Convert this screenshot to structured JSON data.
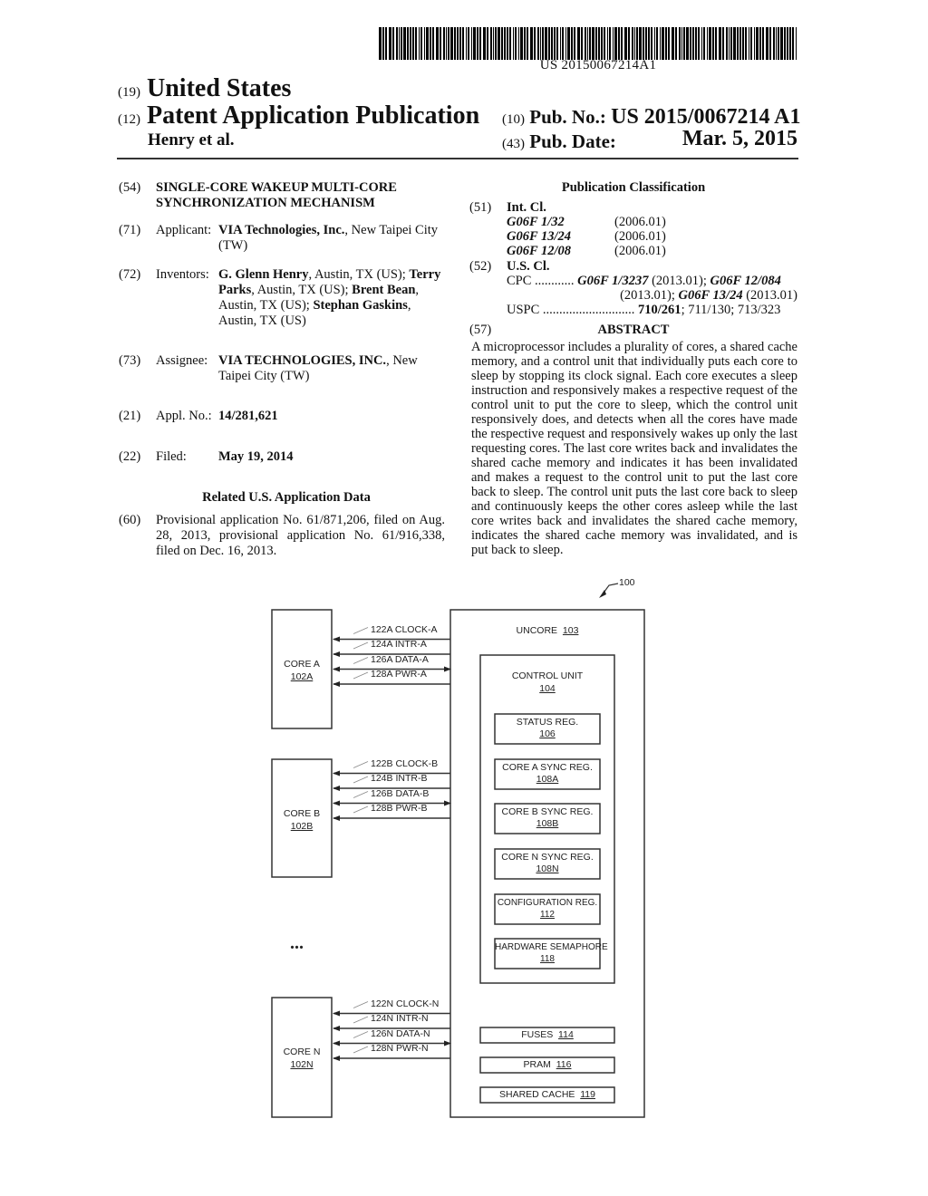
{
  "barcode": {
    "number": "US 20150067214A1"
  },
  "header": {
    "country_code": "(19)",
    "country": "United States",
    "type_code": "(12)",
    "type": "Patent Application Publication",
    "inventor_short": "Henry et al.",
    "pub_no_code": "(10)",
    "pub_no_label": "Pub. No.:",
    "pub_no": "US 2015/0067214 A1",
    "pub_date_code": "(43)",
    "pub_date_label": "Pub. Date:",
    "pub_date": "Mar. 5, 2015"
  },
  "fields": {
    "title": {
      "code": "(54)",
      "value": "SINGLE-CORE WAKEUP MULTI-CORE SYNCHRONIZATION MECHANISM"
    },
    "applicant": {
      "code": "(71)",
      "label": "Applicant:",
      "name": "VIA Technologies, Inc.",
      "location": ", New Taipei City (TW)"
    },
    "inventors": {
      "code": "(72)",
      "label": "Inventors:",
      "list": [
        {
          "name": "G. Glenn Henry",
          "location": ", Austin, TX (US); "
        },
        {
          "name": "Terry Parks",
          "location": ", Austin, TX (US); "
        },
        {
          "name": "Brent Bean",
          "location": ", Austin, TX (US); "
        },
        {
          "name": "Stephan Gaskins",
          "location": ", Austin, TX (US)"
        }
      ]
    },
    "assignee": {
      "code": "(73)",
      "label": "Assignee:",
      "name": "VIA TECHNOLOGIES, INC.",
      "location": ", New Taipei City (TW)"
    },
    "appl_no": {
      "code": "(21)",
      "label": "Appl. No.:",
      "value": "14/281,621"
    },
    "filed": {
      "code": "(22)",
      "label": "Filed:",
      "value": "May 19, 2014"
    },
    "related_title": "Related U.S. Application Data",
    "related": {
      "code": "(60)",
      "value": "Provisional application No. 61/871,206, filed on Aug. 28, 2013, provisional application No. 61/916,338, filed on Dec. 16, 2013."
    }
  },
  "classification": {
    "title": "Publication Classification",
    "int_cl_code": "(51)",
    "int_cl_label": "Int. Cl.",
    "int_cl": [
      {
        "class": "G06F 1/32",
        "version": "(2006.01)"
      },
      {
        "class": "G06F 13/24",
        "version": "(2006.01)"
      },
      {
        "class": "G06F 12/08",
        "version": "(2006.01)"
      }
    ],
    "us_cl_code": "(52)",
    "us_cl_label": "U.S. Cl.",
    "cpc_label": "CPC",
    "cpc_dots": "............",
    "cpc": [
      {
        "class": "G06F 1/3237",
        "version": " (2013.01); "
      },
      {
        "class": "G06F 12/084",
        "version": ""
      },
      {
        "class": "",
        "version": "(2013.01); "
      },
      {
        "class": "G06F 13/24",
        "version": " (2013.01)"
      }
    ],
    "uspc_label": "USPC",
    "uspc_dots": "............................",
    "uspc_main": "710/261",
    "uspc_rest": "; 711/130; 713/323"
  },
  "abstract": {
    "code": "(57)",
    "title": "ABSTRACT",
    "text": "A microprocessor includes a plurality of cores, a shared cache memory, and a control unit that individually puts each core to sleep by stopping its clock signal. Each core executes a sleep instruction and responsively makes a respective request of the control unit to put the core to sleep, which the control unit responsively does, and detects when all the cores have made the respective request and responsively wakes up only the last requesting cores. The last core writes back and invalidates the shared cache memory and indicates it has been invalidated and makes a request to the control unit to put the last core back to sleep. The control unit puts the last core back to sleep and continuously keeps the other cores asleep while the last core writes back and invalidates the shared cache memory, indicates the shared cache memory was invalidated, and is put back to sleep."
  },
  "diagram": {
    "ref": "100",
    "ellipsis": "...",
    "cores": [
      {
        "name": "CORE A",
        "ref": "102A",
        "signals": [
          {
            "ref": "122A",
            "label": "CLOCK-A",
            "dir": "in"
          },
          {
            "ref": "124A",
            "label": "INTR-A",
            "dir": "in"
          },
          {
            "ref": "126A",
            "label": "DATA-A",
            "dir": "bi"
          },
          {
            "ref": "128A",
            "label": "PWR-A",
            "dir": "in"
          }
        ]
      },
      {
        "name": "CORE B",
        "ref": "102B",
        "signals": [
          {
            "ref": "122B",
            "label": "CLOCK-B",
            "dir": "in"
          },
          {
            "ref": "124B",
            "label": "INTR-B",
            "dir": "in"
          },
          {
            "ref": "126B",
            "label": "DATA-B",
            "dir": "bi"
          },
          {
            "ref": "128B",
            "label": "PWR-B",
            "dir": "in"
          }
        ]
      },
      {
        "name": "CORE N",
        "ref": "102N",
        "signals": [
          {
            "ref": "122N",
            "label": "CLOCK-N",
            "dir": "in"
          },
          {
            "ref": "124N",
            "label": "INTR-N",
            "dir": "in"
          },
          {
            "ref": "126N",
            "label": "DATA-N",
            "dir": "bi"
          },
          {
            "ref": "128N",
            "label": "PWR-N",
            "dir": "in"
          }
        ]
      }
    ],
    "uncore": {
      "name": "UNCORE",
      "ref": "103"
    },
    "control_unit": {
      "name": "CONTROL UNIT",
      "ref": "104"
    },
    "registers": [
      {
        "name": "STATUS REG.",
        "ref": "106"
      },
      {
        "name": "CORE A SYNC REG.",
        "ref": "108A"
      },
      {
        "name": "CORE B SYNC REG.",
        "ref": "108B"
      },
      {
        "name": "CORE N SYNC REG.",
        "ref": "108N"
      },
      {
        "name": "CONFIGURATION REG.",
        "ref": "112"
      },
      {
        "name": "HARDWARE SEMAPHORE",
        "ref": "118"
      }
    ],
    "uncore_blocks": [
      {
        "name": "FUSES",
        "ref": "114"
      },
      {
        "name": "PRAM",
        "ref": "116"
      },
      {
        "name": "SHARED CACHE",
        "ref": "119"
      }
    ]
  }
}
